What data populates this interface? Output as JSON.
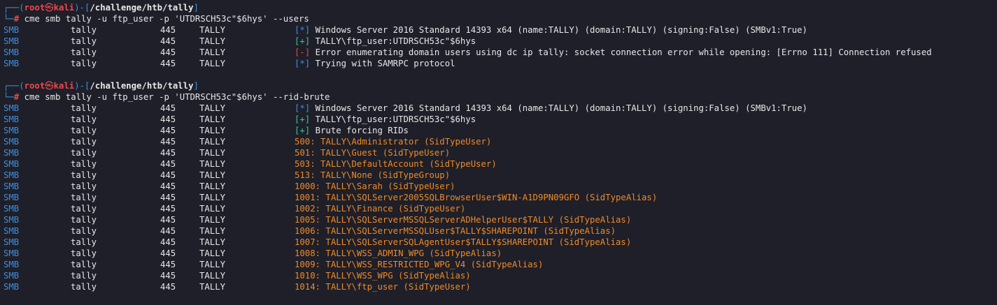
{
  "colors": {
    "background": "#1e1f29",
    "text": "#e8e8e8",
    "blue": "#3e8fe0",
    "green": "#3fc39a",
    "red": "#e24a4a",
    "orange": "#f08a26"
  },
  "prompt": {
    "frame_top": "┌──(",
    "user": "root",
    "at_symbol": "㉿",
    "host": "kali",
    "frame_mid": ")-[",
    "path": "/challenge/htb/tally",
    "frame_end": "]",
    "frame_bottom": "└─",
    "hash": "#"
  },
  "blocks": [
    {
      "command": "cme smb tally -u ftp_user -p 'UTDRSCH53c\"$6hys' --users",
      "rows": [
        {
          "proto": "SMB",
          "host": "tally",
          "port": "445",
          "name": "TALLY",
          "marker": "[*]",
          "marker_type": "blue",
          "text": "Windows Server 2016 Standard 14393 x64 (name:TALLY) (domain:TALLY) (signing:False) (SMBv1:True)",
          "text_color": "default"
        },
        {
          "proto": "SMB",
          "host": "tally",
          "port": "445",
          "name": "TALLY",
          "marker": "[+]",
          "marker_type": "green",
          "text": "TALLY\\ftp_user:UTDRSCH53c\"$6hys",
          "text_color": "default"
        },
        {
          "proto": "SMB",
          "host": "tally",
          "port": "445",
          "name": "TALLY",
          "marker": "[-]",
          "marker_type": "red",
          "text": "Error enumerating domain users using dc ip tally: socket connection error while opening: [Errno 111] Connection refused",
          "text_color": "default"
        },
        {
          "proto": "SMB",
          "host": "tally",
          "port": "445",
          "name": "TALLY",
          "marker": "[*]",
          "marker_type": "blue",
          "text": "Trying with SAMRPC protocol",
          "text_color": "default"
        }
      ]
    },
    {
      "command": "cme smb tally -u ftp_user -p 'UTDRSCH53c\"$6hys' --rid-brute",
      "rows": [
        {
          "proto": "SMB",
          "host": "tally",
          "port": "445",
          "name": "TALLY",
          "marker": "[*]",
          "marker_type": "blue",
          "text": "Windows Server 2016 Standard 14393 x64 (name:TALLY) (domain:TALLY) (signing:False) (SMBv1:True)",
          "text_color": "default"
        },
        {
          "proto": "SMB",
          "host": "tally",
          "port": "445",
          "name": "TALLY",
          "marker": "[+]",
          "marker_type": "green",
          "text": "TALLY\\ftp_user:UTDRSCH53c\"$6hys",
          "text_color": "default"
        },
        {
          "proto": "SMB",
          "host": "tally",
          "port": "445",
          "name": "TALLY",
          "marker": "[+]",
          "marker_type": "green",
          "text": "Brute forcing RIDs",
          "text_color": "default"
        },
        {
          "proto": "SMB",
          "host": "tally",
          "port": "445",
          "name": "TALLY",
          "marker": "",
          "marker_type": "",
          "text": "500: TALLY\\Administrator (SidTypeUser)",
          "text_color": "orange"
        },
        {
          "proto": "SMB",
          "host": "tally",
          "port": "445",
          "name": "TALLY",
          "marker": "",
          "marker_type": "",
          "text": "501: TALLY\\Guest (SidTypeUser)",
          "text_color": "orange"
        },
        {
          "proto": "SMB",
          "host": "tally",
          "port": "445",
          "name": "TALLY",
          "marker": "",
          "marker_type": "",
          "text": "503: TALLY\\DefaultAccount (SidTypeUser)",
          "text_color": "orange"
        },
        {
          "proto": "SMB",
          "host": "tally",
          "port": "445",
          "name": "TALLY",
          "marker": "",
          "marker_type": "",
          "text": "513: TALLY\\None (SidTypeGroup)",
          "text_color": "orange"
        },
        {
          "proto": "SMB",
          "host": "tally",
          "port": "445",
          "name": "TALLY",
          "marker": "",
          "marker_type": "",
          "text": "1000: TALLY\\Sarah (SidTypeUser)",
          "text_color": "orange"
        },
        {
          "proto": "SMB",
          "host": "tally",
          "port": "445",
          "name": "TALLY",
          "marker": "",
          "marker_type": "",
          "text": "1001: TALLY\\SQLServer2005SQLBrowserUser$WIN-A1D9PN09GFO (SidTypeAlias)",
          "text_color": "orange"
        },
        {
          "proto": "SMB",
          "host": "tally",
          "port": "445",
          "name": "TALLY",
          "marker": "",
          "marker_type": "",
          "text": "1002: TALLY\\Finance (SidTypeUser)",
          "text_color": "orange"
        },
        {
          "proto": "SMB",
          "host": "tally",
          "port": "445",
          "name": "TALLY",
          "marker": "",
          "marker_type": "",
          "text": "1005: TALLY\\SQLServerMSSQLServerADHelperUser$TALLY (SidTypeAlias)",
          "text_color": "orange"
        },
        {
          "proto": "SMB",
          "host": "tally",
          "port": "445",
          "name": "TALLY",
          "marker": "",
          "marker_type": "",
          "text": "1006: TALLY\\SQLServerMSSQLUser$TALLY$SHAREPOINT (SidTypeAlias)",
          "text_color": "orange"
        },
        {
          "proto": "SMB",
          "host": "tally",
          "port": "445",
          "name": "TALLY",
          "marker": "",
          "marker_type": "",
          "text": "1007: TALLY\\SQLServerSQLAgentUser$TALLY$SHAREPOINT (SidTypeAlias)",
          "text_color": "orange"
        },
        {
          "proto": "SMB",
          "host": "tally",
          "port": "445",
          "name": "TALLY",
          "marker": "",
          "marker_type": "",
          "text": "1008: TALLY\\WSS_ADMIN_WPG (SidTypeAlias)",
          "text_color": "orange"
        },
        {
          "proto": "SMB",
          "host": "tally",
          "port": "445",
          "name": "TALLY",
          "marker": "",
          "marker_type": "",
          "text": "1009: TALLY\\WSS_RESTRICTED_WPG_V4 (SidTypeAlias)",
          "text_color": "orange"
        },
        {
          "proto": "SMB",
          "host": "tally",
          "port": "445",
          "name": "TALLY",
          "marker": "",
          "marker_type": "",
          "text": "1010: TALLY\\WSS_WPG (SidTypeAlias)",
          "text_color": "orange"
        },
        {
          "proto": "SMB",
          "host": "tally",
          "port": "445",
          "name": "TALLY",
          "marker": "",
          "marker_type": "",
          "text": "1014: TALLY\\ftp_user (SidTypeUser)",
          "text_color": "orange"
        }
      ]
    }
  ]
}
